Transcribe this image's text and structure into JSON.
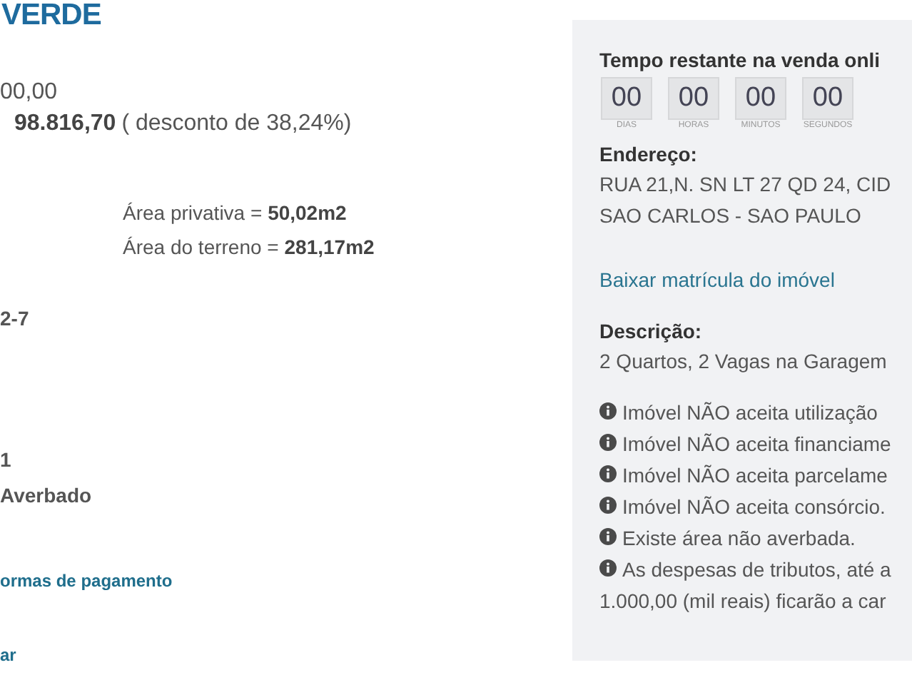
{
  "brand": "VERDE",
  "prices": {
    "original": "00,00",
    "sale": "98.816,70",
    "discount": "( desconto de 38,24%)"
  },
  "areas": [
    "Área privativa = **50,02m2**",
    "Área do terreno = **281,17m2**"
  ],
  "details": [
    "2-7",
    "1",
    "Averbado"
  ],
  "links": [
    "ormas de pagamento",
    "ar"
  ],
  "panel": {
    "countdown_title": "Tempo restante na venda onli",
    "countdown": [
      {
        "value": "00",
        "unit": "DIAS"
      },
      {
        "value": "00",
        "unit": "HORAS"
      },
      {
        "value": "00",
        "unit": "MINUTOS"
      },
      {
        "value": "00",
        "unit": "SEGUNDOS"
      }
    ],
    "address_label": "Endereço:",
    "address_lines": [
      "RUA 21,N. SN LT 27 QD 24, CID",
      "SAO CARLOS - SAO PAULO"
    ],
    "download_link": "Baixar matrícula do imóvel",
    "description_label": "Descrição:",
    "description": "2 Quartos, 2 Vagas na Garagem",
    "notices": [
      {
        "lines": [
          "Imóvel NÃO aceita utilização"
        ]
      },
      {
        "lines": [
          "Imóvel NÃO aceita financiame"
        ]
      },
      {
        "lines": [
          "Imóvel NÃO aceita parcelame"
        ]
      },
      {
        "lines": [
          "Imóvel NÃO aceita consórcio."
        ]
      },
      {
        "lines": [
          "Existe área não averbada."
        ]
      },
      {
        "lines": [
          "As despesas de tributos, até a",
          "1.000,00 (mil reais) ficarão a car"
        ]
      }
    ]
  }
}
